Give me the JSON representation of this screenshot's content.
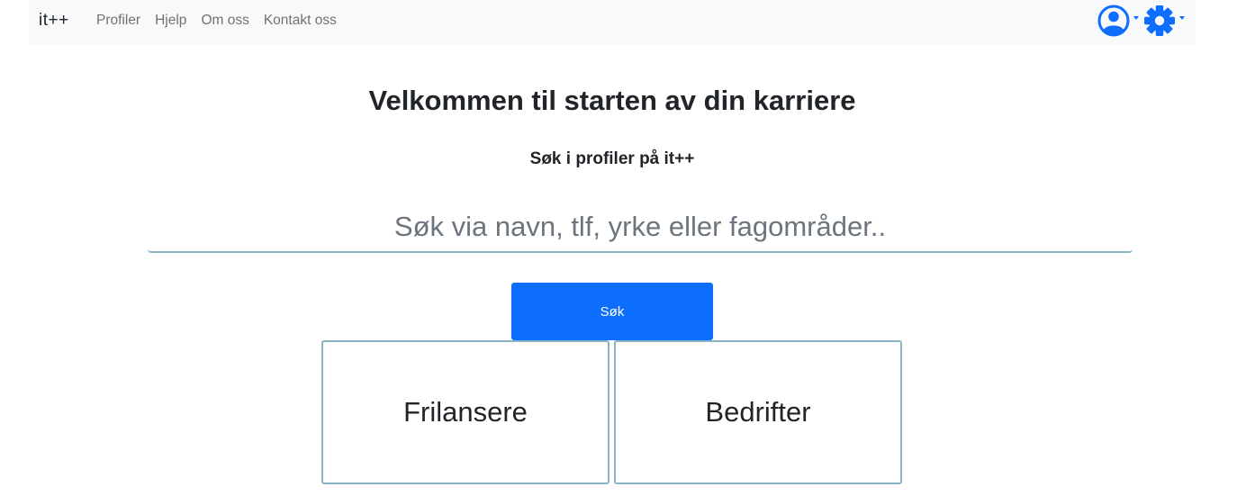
{
  "navbar": {
    "brand": "it++",
    "links": [
      {
        "label": "Profiler"
      },
      {
        "label": "Hjelp"
      },
      {
        "label": "Om oss"
      },
      {
        "label": "Kontakt oss"
      }
    ],
    "icons": {
      "user": "user-circle-icon",
      "settings": "gear-icon",
      "accent_color": "#0d6efd"
    }
  },
  "main": {
    "title": "Velkommen til starten av din karriere",
    "subtitle": "Søk i profiler på it++",
    "search": {
      "placeholder": "Søk via navn, tlf, yrke eller fagområder..",
      "value": ""
    },
    "search_button": "Søk",
    "cards": [
      {
        "label": "Frilansere"
      },
      {
        "label": "Bedrifter"
      }
    ]
  },
  "colors": {
    "primary": "#0d6efd",
    "navbar_bg": "#f8f9fa",
    "border_accent": "#8ab4c3"
  }
}
